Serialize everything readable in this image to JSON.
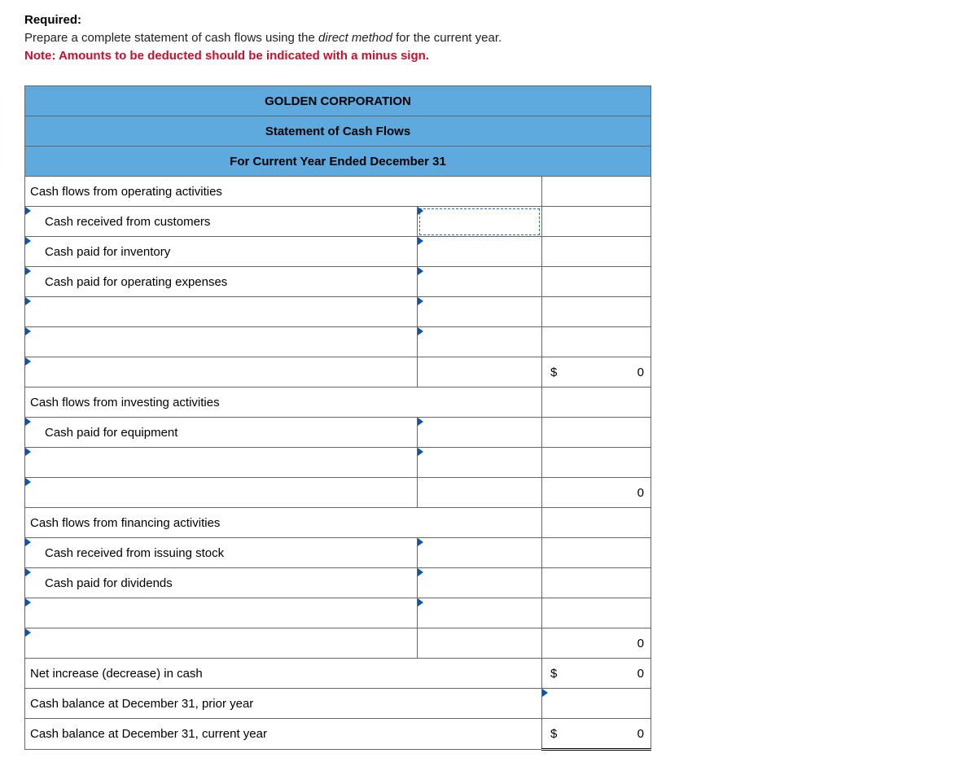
{
  "instructions": {
    "required_label": "Required:",
    "line1_a": "Prepare a complete statement of cash flows using the ",
    "line1_italic": "direct method",
    "line1_b": " for the current year.",
    "note": "Note: Amounts to be deducted should be indicated with a minus sign."
  },
  "header": {
    "company": "GOLDEN CORPORATION",
    "title": "Statement of Cash Flows",
    "period": "For Current Year Ended December 31"
  },
  "sections": {
    "op_header": "Cash flows from operating activities",
    "op_item1": "Cash received from customers",
    "op_item2": "Cash paid for inventory",
    "op_item3": "Cash paid for operating expenses",
    "op_total_sym": "$",
    "op_total_val": "0",
    "inv_header": "Cash flows from investing activities",
    "inv_item1": "Cash paid for equipment",
    "inv_total_val": "0",
    "fin_header": "Cash flows from financing activities",
    "fin_item1": "Cash received from issuing stock",
    "fin_item2": "Cash paid for dividends",
    "fin_total_val": "0",
    "net_label": "Net increase (decrease) in cash",
    "net_sym": "$",
    "net_val": "0",
    "prior_label": "Cash balance at December 31, prior year",
    "curr_label": "Cash balance at December 31, current year",
    "curr_sym": "$",
    "curr_val": "0"
  }
}
